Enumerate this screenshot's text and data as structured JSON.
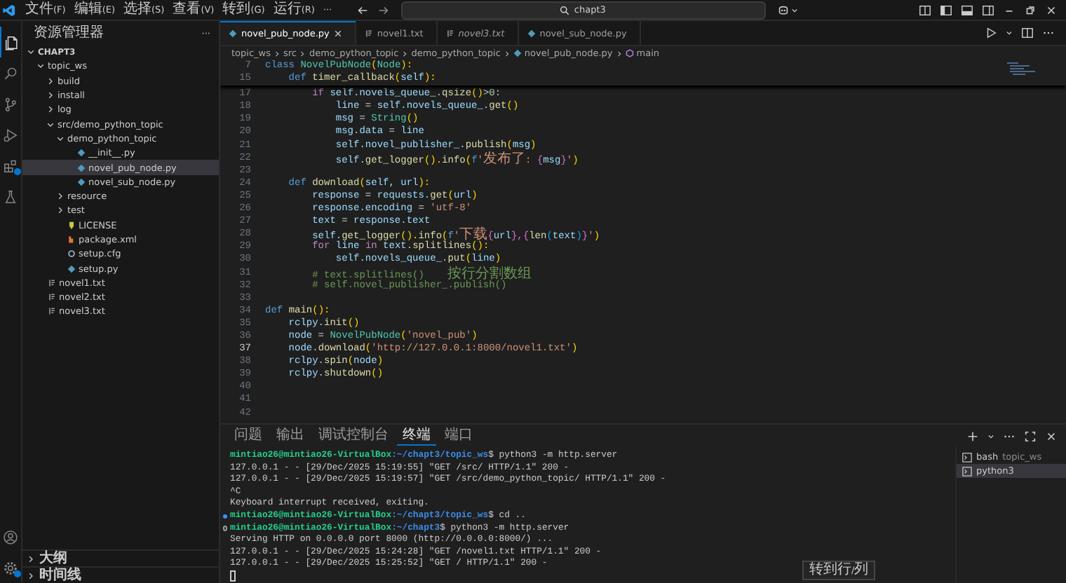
{
  "menu": [
    "文件(F)",
    "编辑(E)",
    "选择(S)",
    "查看(V)",
    "转到(G)",
    "运行(R)"
  ],
  "menu_overflow": "···",
  "command_center": {
    "text": "chapt3"
  },
  "activity_bar": [
    {
      "kind": "explorer",
      "selected": true,
      "badge": false
    },
    {
      "kind": "search",
      "selected": false,
      "badge": false
    },
    {
      "kind": "source_control",
      "selected": false,
      "badge": false
    },
    {
      "kind": "run",
      "selected": false,
      "badge": false
    },
    {
      "kind": "extensions",
      "selected": false,
      "badge": true
    },
    {
      "kind": "testing",
      "selected": false,
      "badge": false
    },
    {
      "kind": "account",
      "selected": false,
      "badge": false
    },
    {
      "kind": "settings",
      "selected": false,
      "badge": true
    }
  ],
  "sidebar": {
    "title": "资源管理器",
    "more": "···",
    "tree": {
      "label": "CHAPT3",
      "kind": "folder",
      "expanded": true,
      "selected": false,
      "children": [
        {
          "label": "topic_ws",
          "kind": "folder",
          "expanded": true,
          "selected": false,
          "children": [
            {
              "label": "build",
              "kind": "folder",
              "expanded": false,
              "selected": false
            },
            {
              "label": "install",
              "kind": "folder",
              "expanded": false,
              "selected": false
            },
            {
              "label": "log",
              "kind": "folder",
              "expanded": false,
              "selected": false
            },
            {
              "label": "src/demo_python_topic",
              "kind": "folder",
              "expanded": true,
              "selected": false,
              "children": [
                {
                  "label": "demo_python_topic",
                  "kind": "folder",
                  "expanded": true,
                  "selected": false,
                  "children": [
                    {
                      "label": "__init__.py",
                      "kind": "python",
                      "selected": false
                    },
                    {
                      "label": "novel_pub_node.py",
                      "kind": "python",
                      "selected": true
                    },
                    {
                      "label": "novel_sub_node.py",
                      "kind": "python",
                      "selected": false
                    }
                  ]
                },
                {
                  "label": "resource",
                  "kind": "folder",
                  "expanded": false,
                  "selected": false
                },
                {
                  "label": "test",
                  "kind": "folder",
                  "expanded": false,
                  "selected": false
                },
                {
                  "label": "LICENSE",
                  "kind": "license",
                  "selected": false
                },
                {
                  "label": "package.xml",
                  "kind": "xml",
                  "selected": false
                },
                {
                  "label": "setup.cfg",
                  "kind": "config",
                  "selected": false
                },
                {
                  "label": "setup.py",
                  "kind": "python",
                  "selected": false
                }
              ]
            }
          ]
        },
        {
          "label": "novel1.txt",
          "kind": "text",
          "selected": false
        },
        {
          "label": "novel2.txt",
          "kind": "text",
          "selected": false
        },
        {
          "label": "novel3.txt",
          "kind": "text",
          "selected": false
        }
      ]
    },
    "sections": [
      {
        "label": "大纲",
        "expanded": false
      },
      {
        "label": "时间线",
        "expanded": false
      }
    ]
  },
  "tabs": [
    {
      "label": "novel_pub_node.py",
      "kind": "python",
      "selected": true,
      "preview": false
    },
    {
      "label": "novel1.txt",
      "kind": "text",
      "selected": false,
      "preview": false
    },
    {
      "label": "novel3.txt",
      "kind": "text",
      "selected": false,
      "preview": true
    },
    {
      "label": "novel_sub_node.py",
      "kind": "python",
      "selected": false,
      "preview": false
    }
  ],
  "breadcrumb": [
    {
      "label": "topic_ws",
      "kind": "folder"
    },
    {
      "label": "src",
      "kind": "folder"
    },
    {
      "label": "demo_python_topic",
      "kind": "folder"
    },
    {
      "label": "demo_python_topic",
      "kind": "folder"
    },
    {
      "label": "novel_pub_node.py",
      "kind": "python"
    },
    {
      "label": "main",
      "kind": "function"
    }
  ],
  "code": {
    "sticky": [
      {
        "n": "7",
        "tokens": [
          {
            "kind": "kw",
            "text": "class "
          },
          {
            "kind": "cls",
            "text": "NovelPubNode"
          },
          {
            "kind": "b1",
            "text": "("
          },
          {
            "kind": "cls",
            "text": "Node"
          },
          {
            "kind": "b1",
            "text": "):"
          }
        ]
      },
      {
        "n": "15",
        "tokens": [
          {
            "kind": "kw",
            "text": "    def "
          },
          {
            "kind": "fn",
            "text": "timer_callback"
          },
          {
            "kind": "b1",
            "text": "("
          },
          {
            "kind": "var",
            "text": "self"
          },
          {
            "kind": "b1",
            "text": "):"
          }
        ]
      }
    ],
    "lines": [
      {
        "n": "17",
        "current": false,
        "tokens": [
          {
            "kind": "ctl",
            "text": "        if "
          },
          {
            "kind": "var",
            "text": "self.novels_queue_."
          },
          {
            "kind": "fn",
            "text": "qsize"
          },
          {
            "kind": "b1",
            "text": "()"
          },
          {
            "kind": "p",
            "text": ">"
          },
          {
            "kind": "num",
            "text": "0:"
          }
        ]
      },
      {
        "n": "18",
        "current": false,
        "tokens": [
          {
            "kind": "var",
            "text": "            line"
          },
          {
            "kind": "p",
            "text": " = "
          },
          {
            "kind": "var",
            "text": "self.novels_queue_."
          },
          {
            "kind": "fn",
            "text": "get"
          },
          {
            "kind": "b1",
            "text": "()"
          }
        ]
      },
      {
        "n": "19",
        "current": false,
        "tokens": [
          {
            "kind": "var",
            "text": "            msg"
          },
          {
            "kind": "p",
            "text": " = "
          },
          {
            "kind": "cls",
            "text": "String"
          },
          {
            "kind": "b1",
            "text": "()"
          }
        ]
      },
      {
        "n": "20",
        "current": false,
        "tokens": [
          {
            "kind": "var",
            "text": "            msg.data"
          },
          {
            "kind": "p",
            "text": " = "
          },
          {
            "kind": "var",
            "text": "line"
          }
        ]
      },
      {
        "n": "21",
        "current": false,
        "tokens": [
          {
            "kind": "var",
            "text": "            self.novel_publisher_."
          },
          {
            "kind": "fn",
            "text": "publish"
          },
          {
            "kind": "b1",
            "text": "("
          },
          {
            "kind": "var",
            "text": "msg"
          },
          {
            "kind": "b1",
            "text": ")"
          }
        ]
      },
      {
        "n": "22",
        "current": false,
        "tokens": [
          {
            "kind": "var",
            "text": "            self."
          },
          {
            "kind": "fn",
            "text": "get_logger"
          },
          {
            "kind": "b1",
            "text": "()."
          },
          {
            "kind": "fn",
            "text": "info"
          },
          {
            "kind": "b1",
            "text": "("
          },
          {
            "kind": "kw",
            "text": "f"
          },
          {
            "kind": "str",
            "text": "'发布了: "
          },
          {
            "kind": "b2",
            "text": "{"
          },
          {
            "kind": "var",
            "text": "msg"
          },
          {
            "kind": "b2",
            "text": "}"
          },
          {
            "kind": "str",
            "text": "'"
          },
          {
            "kind": "b1",
            "text": ")"
          }
        ]
      },
      {
        "n": "23",
        "current": false
      },
      {
        "n": "24",
        "current": false,
        "tokens": [
          {
            "kind": "kw",
            "text": "    def "
          },
          {
            "kind": "fn",
            "text": "download"
          },
          {
            "kind": "b1",
            "text": "("
          },
          {
            "kind": "var",
            "text": "self, url"
          },
          {
            "kind": "b1",
            "text": "):"
          }
        ]
      },
      {
        "n": "25",
        "current": false,
        "tokens": [
          {
            "kind": "var",
            "text": "        response"
          },
          {
            "kind": "p",
            "text": " = "
          },
          {
            "kind": "var",
            "text": "requests."
          },
          {
            "kind": "fn",
            "text": "get"
          },
          {
            "kind": "b1",
            "text": "("
          },
          {
            "kind": "var",
            "text": "url"
          },
          {
            "kind": "b1",
            "text": ")"
          }
        ]
      },
      {
        "n": "26",
        "current": false,
        "tokens": [
          {
            "kind": "var",
            "text": "        response.encoding"
          },
          {
            "kind": "p",
            "text": " = "
          },
          {
            "kind": "str",
            "text": "'utf-8'"
          }
        ]
      },
      {
        "n": "27",
        "current": false,
        "tokens": [
          {
            "kind": "var",
            "text": "        text"
          },
          {
            "kind": "p",
            "text": " = "
          },
          {
            "kind": "var",
            "text": "response.text"
          }
        ]
      },
      {
        "n": "28",
        "current": false,
        "tokens": [
          {
            "kind": "var",
            "text": "        self."
          },
          {
            "kind": "fn",
            "text": "get_logger"
          },
          {
            "kind": "b1",
            "text": "()."
          },
          {
            "kind": "fn",
            "text": "info"
          },
          {
            "kind": "b1",
            "text": "("
          },
          {
            "kind": "kw",
            "text": "f"
          },
          {
            "kind": "str",
            "text": "'下载"
          },
          {
            "kind": "b2",
            "text": "{"
          },
          {
            "kind": "var",
            "text": "url"
          },
          {
            "kind": "b2",
            "text": "},{"
          },
          {
            "kind": "fn",
            "text": "len"
          },
          {
            "kind": "b3",
            "text": "("
          },
          {
            "kind": "var",
            "text": "text"
          },
          {
            "kind": "b3",
            "text": ")"
          },
          {
            "kind": "b2",
            "text": "}"
          },
          {
            "kind": "str",
            "text": "'"
          },
          {
            "kind": "b1",
            "text": ")"
          }
        ]
      },
      {
        "n": "29",
        "current": false,
        "tokens": [
          {
            "kind": "ctl",
            "text": "        for "
          },
          {
            "kind": "var",
            "text": "line "
          },
          {
            "kind": "ctl",
            "text": "in "
          },
          {
            "kind": "var",
            "text": "text."
          },
          {
            "kind": "fn",
            "text": "splitlines"
          },
          {
            "kind": "b1",
            "text": "():"
          }
        ]
      },
      {
        "n": "30",
        "current": false,
        "tokens": [
          {
            "kind": "var",
            "text": "            self.novels_queue_."
          },
          {
            "kind": "fn",
            "text": "put"
          },
          {
            "kind": "b1",
            "text": "("
          },
          {
            "kind": "var",
            "text": "line"
          },
          {
            "kind": "b1",
            "text": ")"
          }
        ]
      },
      {
        "n": "31",
        "current": false,
        "tokens": [
          {
            "kind": "cmt",
            "text": "        # text.splitlines()    按行分割数组"
          }
        ]
      },
      {
        "n": "32",
        "current": false,
        "tokens": [
          {
            "kind": "cmt",
            "text": "        # self.novel_publisher_.publish()"
          }
        ]
      },
      {
        "n": "33",
        "current": false
      },
      {
        "n": "34",
        "current": false,
        "tokens": [
          {
            "kind": "kw",
            "text": "def "
          },
          {
            "kind": "fn",
            "text": "main"
          },
          {
            "kind": "b1",
            "text": "():"
          }
        ]
      },
      {
        "n": "35",
        "current": false,
        "tokens": [
          {
            "kind": "var",
            "text": "    rclpy."
          },
          {
            "kind": "fn",
            "text": "init"
          },
          {
            "kind": "b1",
            "text": "()"
          }
        ]
      },
      {
        "n": "36",
        "current": false,
        "tokens": [
          {
            "kind": "var",
            "text": "    node"
          },
          {
            "kind": "p",
            "text": " = "
          },
          {
            "kind": "cls",
            "text": "NovelPubNode"
          },
          {
            "kind": "b1",
            "text": "("
          },
          {
            "kind": "str",
            "text": "'novel_pub'"
          },
          {
            "kind": "b1",
            "text": ")"
          }
        ]
      },
      {
        "n": "37",
        "current": true,
        "tokens": [
          {
            "kind": "var",
            "text": "    node."
          },
          {
            "kind": "fn",
            "text": "download"
          },
          {
            "kind": "b1",
            "text": "("
          },
          {
            "kind": "str",
            "text": "'http://127.0.0.1:8000/novel1.txt'"
          },
          {
            "kind": "b1",
            "text": ")"
          }
        ]
      },
      {
        "n": "38",
        "current": false,
        "tokens": [
          {
            "kind": "var",
            "text": "    rclpy."
          },
          {
            "kind": "fn",
            "text": "spin"
          },
          {
            "kind": "b1",
            "text": "("
          },
          {
            "kind": "var",
            "text": "node"
          },
          {
            "kind": "b1",
            "text": ")"
          }
        ]
      },
      {
        "n": "39",
        "current": false,
        "tokens": [
          {
            "kind": "var",
            "text": "    rclpy."
          },
          {
            "kind": "fn",
            "text": "shutdown"
          },
          {
            "kind": "b1",
            "text": "()"
          }
        ]
      },
      {
        "n": "40",
        "current": false
      },
      {
        "n": "41",
        "current": false
      },
      {
        "n": "42",
        "current": false
      }
    ]
  },
  "panel": {
    "tabs": [
      {
        "label": "问题",
        "selected": false
      },
      {
        "label": "输出",
        "selected": false
      },
      {
        "label": "调试控制台",
        "selected": false
      },
      {
        "label": "终端",
        "selected": true
      },
      {
        "label": "端口",
        "selected": false
      }
    ],
    "terminal_lines": [
      {
        "kind": "prompt",
        "user": "mintiao26@mintiao26-VirtualBox",
        "path": ":~/chapt3/topic_ws",
        "command": "$ python3 -m http.server"
      },
      {
        "kind": "output",
        "text": "127.0.0.1 - - [29/Dec/2025 15:19:55] \"GET /src/ HTTP/1.1\" 200 -"
      },
      {
        "kind": "output",
        "text": "127.0.0.1 - - [29/Dec/2025 15:19:57] \"GET /src/demo_python_topic/ HTTP/1.1\" 200 -"
      },
      {
        "kind": "output",
        "text": "^C"
      },
      {
        "kind": "output",
        "text": "Keyboard interrupt received, exiting."
      },
      {
        "kind": "prompt",
        "success": true,
        "user": "mintiao26@mintiao26-VirtualBox",
        "path": ":~/chapt3/topic_ws",
        "command": "$ cd .."
      },
      {
        "kind": "prompt",
        "success": false,
        "user": "mintiao26@mintiao26-VirtualBox",
        "path": ":~/chapt3",
        "command": "$ python3 -m http.server"
      },
      {
        "kind": "output",
        "text": "Serving HTTP on 0.0.0.0 port 8000 (http://0.0.0.0:8000/) ..."
      },
      {
        "kind": "output",
        "text": "127.0.0.1 - - [29/Dec/2025 15:24:28] \"GET /novel1.txt HTTP/1.1\" 200 -"
      },
      {
        "kind": "output",
        "text": "127.0.0.1 - - [29/Dec/2025 15:25:52] \"GET / HTTP/1.1\" 200 -"
      },
      {
        "kind": "cursor"
      }
    ],
    "terminals": [
      {
        "name": "bash",
        "detail": "topic_ws",
        "selected": false
      },
      {
        "name": "python3",
        "selected": true
      }
    ]
  },
  "tooltip": "转到行/列"
}
